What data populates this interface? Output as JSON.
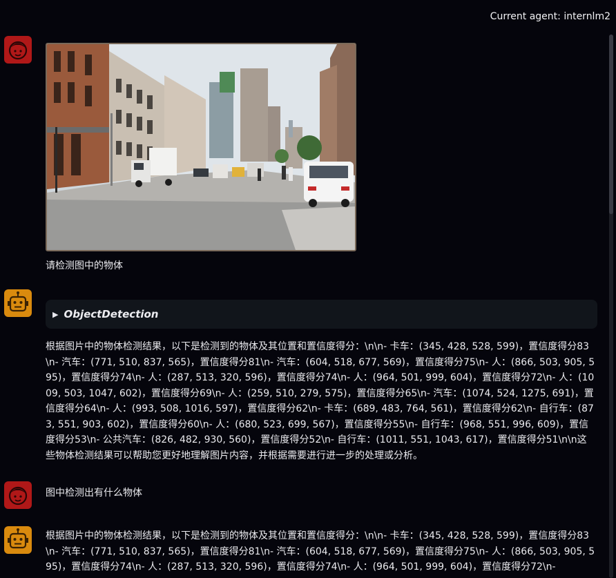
{
  "header": {
    "agent_label": "Current agent: internlm2"
  },
  "conversation": {
    "msg1_text": "请检测图中的物体",
    "tool_name": "ObjectDetection",
    "answer1": "根据图片中的物体检测结果，以下是检测到的物体及其位置和置信度得分：\\n\\n- 卡车：(345, 428, 528, 599)，置信度得分83\\n- 汽车：(771, 510, 837, 565)，置信度得分81\\n- 汽车：(604, 518, 677, 569)，置信度得分75\\n- 人：(866, 503, 905, 595)，置信度得分74\\n- 人：(287, 513, 320, 596)，置信度得分74\\n- 人：(964, 501, 999, 604)，置信度得分72\\n- 人：(1009, 503, 1047, 602)，置信度得分69\\n- 人：(259, 510, 279, 575)，置信度得分65\\n- 汽车：(1074, 524, 1275, 691)，置信度得分64\\n- 人：(993, 508, 1016, 597)，置信度得分62\\n- 卡车：(689, 483, 764, 561)，置信度得分62\\n- 自行车：(873, 551, 903, 602)，置信度得分60\\n- 人：(680, 523, 699, 567)，置信度得分55\\n- 自行车：(968, 551, 996, 609)，置信度得分53\\n- 公共汽车：(826, 482, 930, 560)，置信度得分52\\n- 自行车：(1011, 551, 1043, 617)，置信度得分51\\n\\n这些物体检测结果可以帮助您更好地理解图片内容，并根据需要进行进一步的处理或分析。",
    "msg2_text": "图中检测出有什么物体",
    "answer2": "根据图片中的物体检测结果，以下是检测到的物体及其位置和置信度得分：\\n\\n- 卡车：(345, 428, 528, 599)，置信度得分83\\n- 汽车：(771, 510, 837, 565)，置信度得分81\\n- 汽车：(604, 518, 677, 569)，置信度得分75\\n- 人：(866, 503, 905, 595)，置信度得分74\\n- 人：(287, 513, 320, 596)，置信度得分74\\n- 人：(964, 501, 999, 604)，置信度得分72\\n-"
  },
  "icons": {
    "user_avatar": "user-face-icon",
    "bot_avatar": "robot-face-icon",
    "tool_toggle": "triangle-right-icon"
  },
  "colors": {
    "background": "#05050c",
    "user_avatar_bg": "#b01818",
    "bot_avatar_bg": "#d98a0e",
    "tool_box_bg": "#11151b"
  }
}
